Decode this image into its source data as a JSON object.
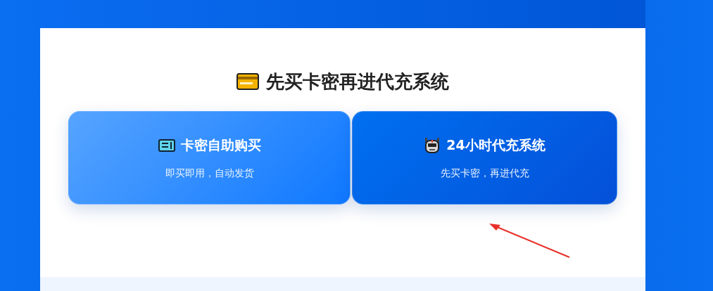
{
  "section": {
    "title": "先买卡密再进代充系统"
  },
  "cards": [
    {
      "kind": "ticket",
      "title": "卡密自助购买",
      "subtitle": "即买即用，自动发货"
    },
    {
      "kind": "robot",
      "title": "24小时代充系统",
      "subtitle": "先买卡密，再进代充"
    }
  ]
}
